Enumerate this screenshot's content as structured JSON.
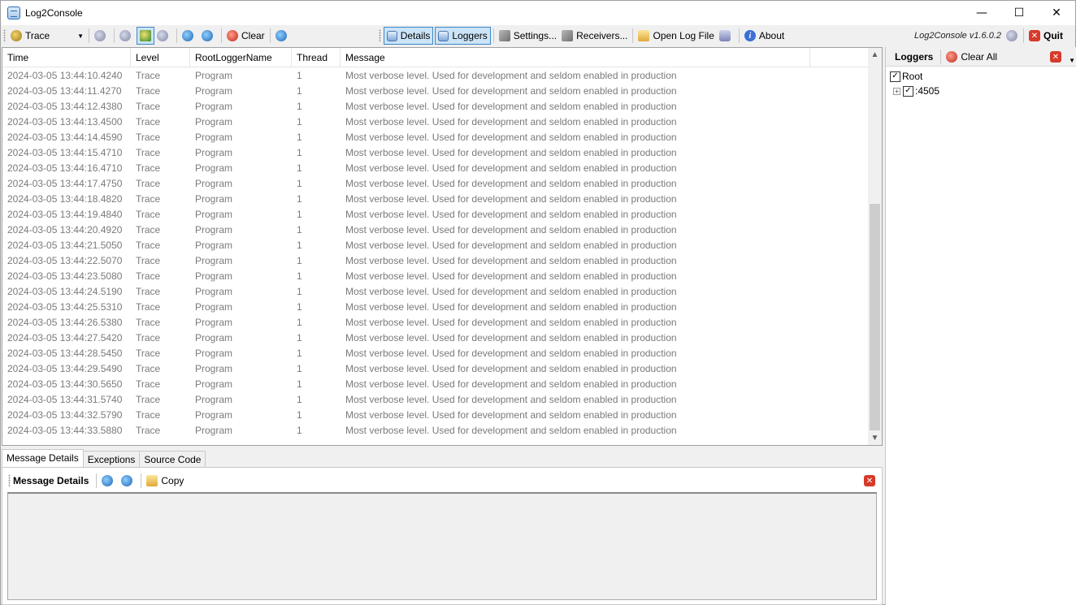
{
  "window": {
    "title": "Log2Console",
    "controls": {
      "minimize": "—",
      "maximize": "☐",
      "close": "✕"
    }
  },
  "toolbar": {
    "level_value": "Trace",
    "clear_label": "Clear",
    "details_label": "Details",
    "loggers_label": "Loggers",
    "settings_label": "Settings...",
    "receivers_label": "Receivers...",
    "open_log_label": "Open Log File",
    "about_label": "About",
    "version": "Log2Console v1.6.0.2",
    "quit_label": "Quit"
  },
  "log": {
    "columns": [
      "Time",
      "Level",
      "RootLoggerName",
      "Thread",
      "Message"
    ],
    "rows": [
      [
        "2024-03-05 13:44:10.4240",
        "Trace",
        "Program",
        "1",
        "Most verbose level. Used for development and seldom enabled in production"
      ],
      [
        "2024-03-05 13:44:11.4270",
        "Trace",
        "Program",
        "1",
        "Most verbose level. Used for development and seldom enabled in production"
      ],
      [
        "2024-03-05 13:44:12.4380",
        "Trace",
        "Program",
        "1",
        "Most verbose level. Used for development and seldom enabled in production"
      ],
      [
        "2024-03-05 13:44:13.4500",
        "Trace",
        "Program",
        "1",
        "Most verbose level. Used for development and seldom enabled in production"
      ],
      [
        "2024-03-05 13:44:14.4590",
        "Trace",
        "Program",
        "1",
        "Most verbose level. Used for development and seldom enabled in production"
      ],
      [
        "2024-03-05 13:44:15.4710",
        "Trace",
        "Program",
        "1",
        "Most verbose level. Used for development and seldom enabled in production"
      ],
      [
        "2024-03-05 13:44:16.4710",
        "Trace",
        "Program",
        "1",
        "Most verbose level. Used for development and seldom enabled in production"
      ],
      [
        "2024-03-05 13:44:17.4750",
        "Trace",
        "Program",
        "1",
        "Most verbose level. Used for development and seldom enabled in production"
      ],
      [
        "2024-03-05 13:44:18.4820",
        "Trace",
        "Program",
        "1",
        "Most verbose level. Used for development and seldom enabled in production"
      ],
      [
        "2024-03-05 13:44:19.4840",
        "Trace",
        "Program",
        "1",
        "Most verbose level. Used for development and seldom enabled in production"
      ],
      [
        "2024-03-05 13:44:20.4920",
        "Trace",
        "Program",
        "1",
        "Most verbose level. Used for development and seldom enabled in production"
      ],
      [
        "2024-03-05 13:44:21.5050",
        "Trace",
        "Program",
        "1",
        "Most verbose level. Used for development and seldom enabled in production"
      ],
      [
        "2024-03-05 13:44:22.5070",
        "Trace",
        "Program",
        "1",
        "Most verbose level. Used for development and seldom enabled in production"
      ],
      [
        "2024-03-05 13:44:23.5080",
        "Trace",
        "Program",
        "1",
        "Most verbose level. Used for development and seldom enabled in production"
      ],
      [
        "2024-03-05 13:44:24.5190",
        "Trace",
        "Program",
        "1",
        "Most verbose level. Used for development and seldom enabled in production"
      ],
      [
        "2024-03-05 13:44:25.5310",
        "Trace",
        "Program",
        "1",
        "Most verbose level. Used for development and seldom enabled in production"
      ],
      [
        "2024-03-05 13:44:26.5380",
        "Trace",
        "Program",
        "1",
        "Most verbose level. Used for development and seldom enabled in production"
      ],
      [
        "2024-03-05 13:44:27.5420",
        "Trace",
        "Program",
        "1",
        "Most verbose level. Used for development and seldom enabled in production"
      ],
      [
        "2024-03-05 13:44:28.5450",
        "Trace",
        "Program",
        "1",
        "Most verbose level. Used for development and seldom enabled in production"
      ],
      [
        "2024-03-05 13:44:29.5490",
        "Trace",
        "Program",
        "1",
        "Most verbose level. Used for development and seldom enabled in production"
      ],
      [
        "2024-03-05 13:44:30.5650",
        "Trace",
        "Program",
        "1",
        "Most verbose level. Used for development and seldom enabled in production"
      ],
      [
        "2024-03-05 13:44:31.5740",
        "Trace",
        "Program",
        "1",
        "Most verbose level. Used for development and seldom enabled in production"
      ],
      [
        "2024-03-05 13:44:32.5790",
        "Trace",
        "Program",
        "1",
        "Most verbose level. Used for development and seldom enabled in production"
      ],
      [
        "2024-03-05 13:44:33.5880",
        "Trace",
        "Program",
        "1",
        "Most verbose level. Used for development and seldom enabled in production"
      ]
    ]
  },
  "tabs": {
    "message_details": "Message Details",
    "exceptions": "Exceptions",
    "source_code": "Source Code"
  },
  "details": {
    "title": "Message Details",
    "copy_label": "Copy"
  },
  "loggers": {
    "title": "Loggers",
    "clear_all_label": "Clear All",
    "tree": {
      "root": "Root",
      "child": ":4505"
    }
  },
  "colors": {
    "row_text": "#7a7a7a",
    "active_button_bg": "#cce4f7",
    "active_button_border": "#3d86c6",
    "close_red": "#d63a2a"
  },
  "icons": [
    "app-icon",
    "trace-level-icon",
    "pause-icon",
    "back-icon",
    "refresh-icon",
    "forward-icon",
    "zoom-in-icon",
    "zoom-out-icon",
    "clear-icon",
    "search-icon",
    "details-icon",
    "loggers-icon",
    "settings-icon",
    "receivers-icon",
    "open-folder-icon",
    "robot-icon",
    "about-icon",
    "version-icon",
    "quit-icon"
  ]
}
